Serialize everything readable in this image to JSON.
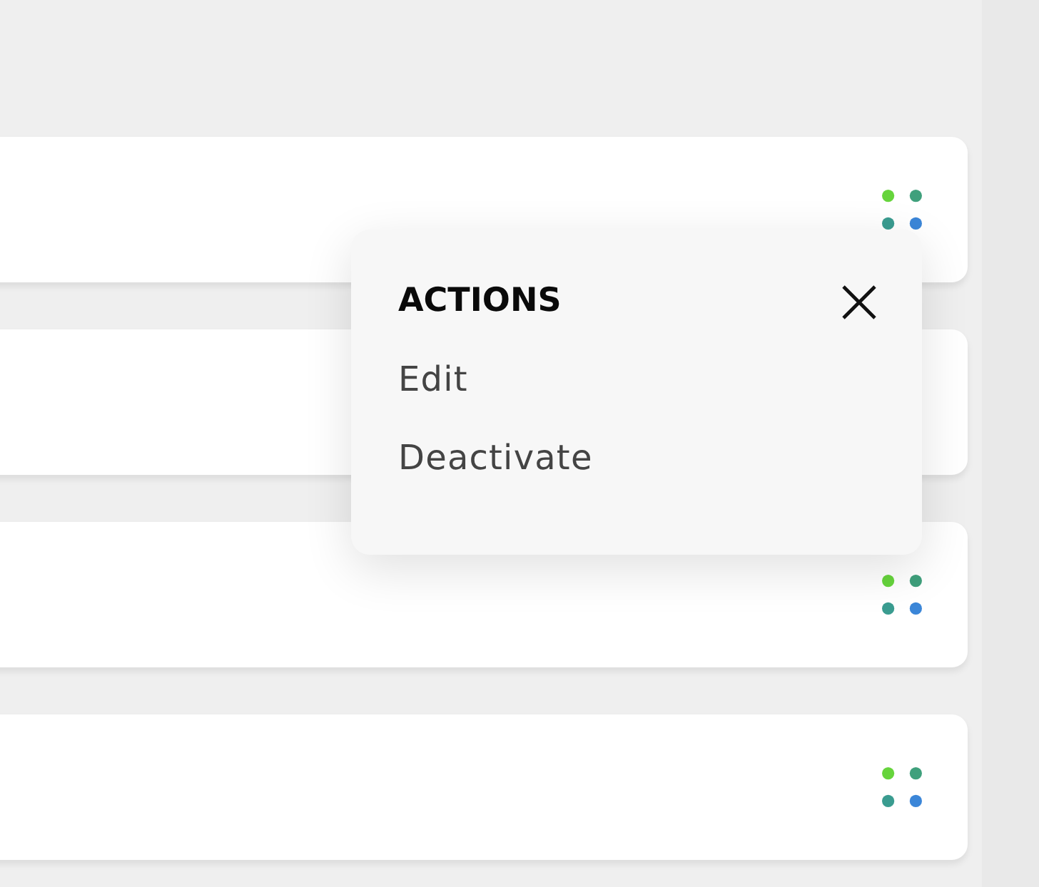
{
  "cards": [
    {
      "menu_open": true
    },
    {
      "menu_open": false
    },
    {
      "menu_open": false
    },
    {
      "menu_open": false
    }
  ],
  "action_menu": {
    "title": "ACTIONS",
    "items": [
      {
        "label": "Edit"
      },
      {
        "label": "Deactivate"
      }
    ]
  }
}
